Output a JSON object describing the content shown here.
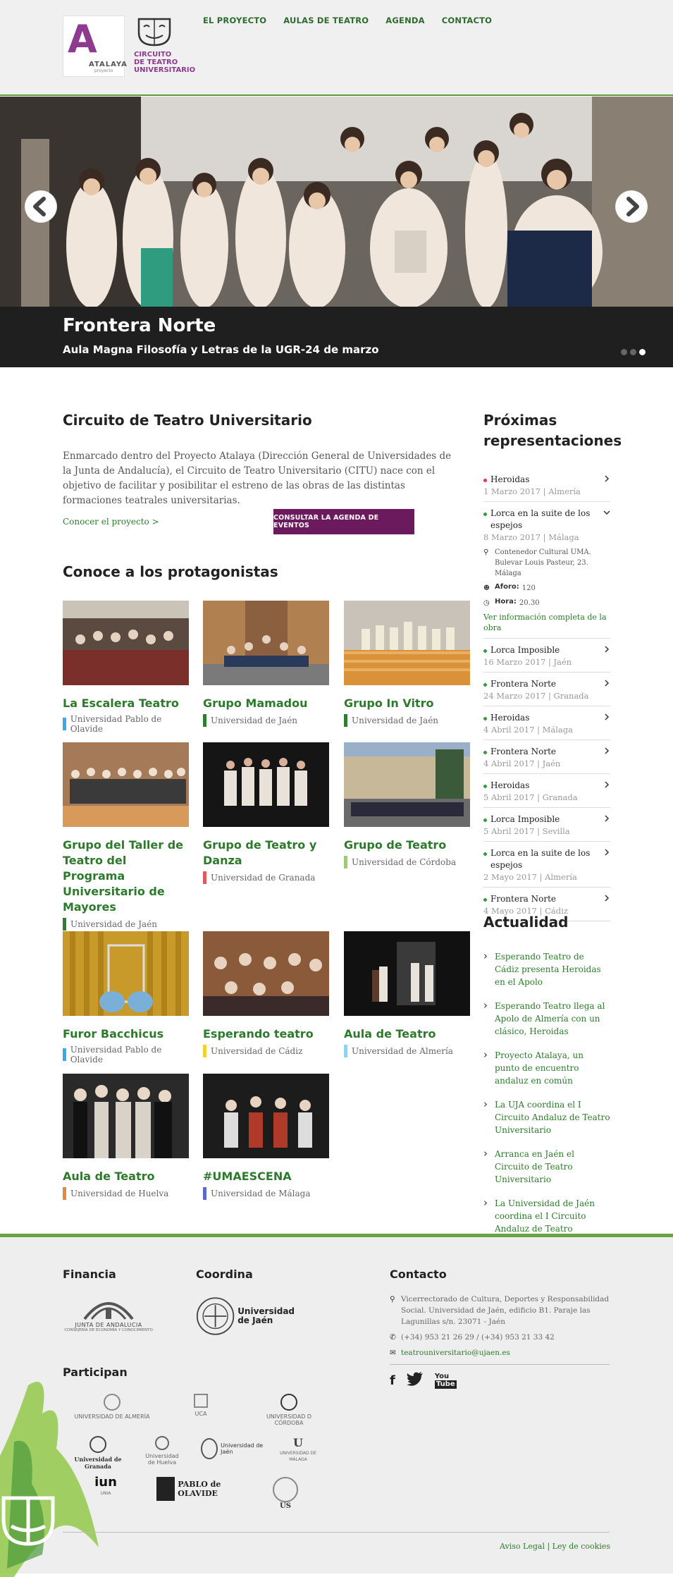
{
  "header": {
    "atalaya_word": "ATALAYA",
    "atalaya_sub": "proyecto",
    "citu_line1": "CIRCUITO",
    "citu_line2": "DE TEATRO",
    "citu_line3": "UNIVERSITARIO",
    "nav": [
      "EL PROYECTO",
      "AULAS DE TEATRO",
      "AGENDA",
      "CONTACTO"
    ]
  },
  "hero": {
    "title": "Frontera Norte",
    "subtitle": "Aula Magna Filosofía y Letras de la UGR-24 de marzo",
    "slides": 3,
    "active_slide": 3
  },
  "intro": {
    "heading": "Circuito de Teatro Universitario",
    "text": "Enmarcado dentro del Proyecto Atalaya (Dirección General de Universidades de la Junta de Andalucía), el Circuito de Teatro Universitario (CITU) nace con el objetivo de facilitar y posibilitar el estreno de las obras de las distintas formaciones teatrales universitarias.",
    "link": "Conocer el proyecto >",
    "button": "CONSULTAR LA AGENDA DE EVENTOS"
  },
  "protagonists": {
    "heading": "Conoce a los protagonistas",
    "cards": [
      {
        "name": "La Escalera Teatro",
        "uni": "Universidad Pablo de Olavide",
        "color": "#3aace0"
      },
      {
        "name": "Grupo Mamadou",
        "uni": "Universidad de Jaén",
        "color": "#2e7d32"
      },
      {
        "name": "Grupo In Vitro",
        "uni": "Universidad de Jaén",
        "color": "#2e7d32"
      },
      {
        "name": "Grupo del Taller de Teatro del Programa Universitario de Mayores",
        "uni": "Universidad de Jaén",
        "color": "#2e7d32"
      },
      {
        "name": "Grupo de Teatro y Danza",
        "uni": "Universidad de Granada",
        "color": "#e05a5a"
      },
      {
        "name": "Grupo de Teatro",
        "uni": "Universidad de Córdoba",
        "color": "#9cc87a"
      },
      {
        "name": "Furor Bacchicus",
        "uni": "Universidad Pablo de Olavide",
        "color": "#3aace0"
      },
      {
        "name": "Esperando teatro",
        "uni": "Universidad de Cádiz",
        "color": "#f2d22e"
      },
      {
        "name": "Aula de Teatro",
        "uni": "Universidad de Almería",
        "color": "#8fd3f0"
      },
      {
        "name": "Aula de Teatro",
        "uni": "Universidad de Huelva",
        "color": "#e08a3a"
      },
      {
        "name": "#UMAESCENA",
        "uni": "Universidad de Málaga",
        "color": "#5a6acb"
      }
    ]
  },
  "upcoming": {
    "heading": "Próximas representaciones",
    "events": [
      {
        "title": "Heroidas",
        "meta": "1 Marzo 2017 | Almería",
        "bullet": "#e03a3a"
      },
      {
        "title": "Lorca en la suite de los espejos",
        "meta": "8 Marzo 2017 | Málaga",
        "bullet": "#3c9a3c",
        "expanded": true,
        "venue": "Contenedor Cultural UMA. Bulevar Louis Pasteur, 23. Málaga",
        "aforo_label": "Aforo:",
        "aforo": "120",
        "hora_label": "Hora:",
        "hora": "20.30",
        "more": "Ver información completa de la obra"
      },
      {
        "title": "Lorca Imposible",
        "meta": "16 Marzo 2017 | Jaén",
        "bullet": "#3c9a3c"
      },
      {
        "title": "Frontera Norte",
        "meta": "24 Marzo 2017 | Granada",
        "bullet": "#3c9a3c"
      },
      {
        "title": "Heroidas",
        "meta": "4 Abril 2017 | Málaga",
        "bullet": "#3c9a3c"
      },
      {
        "title": "Frontera Norte",
        "meta": "4 Abril 2017 | Jaén",
        "bullet": "#3c9a3c"
      },
      {
        "title": "Heroidas",
        "meta": "5 Abril 2017 | Granada",
        "bullet": "#3c9a3c"
      },
      {
        "title": "Lorca Imposible",
        "meta": "5 Abril 2017 | Sevilla",
        "bullet": "#3c9a3c"
      },
      {
        "title": "Lorca en la suite de los espejos",
        "meta": "2 Mayo 2017 | Almería",
        "bullet": "#3c9a3c"
      },
      {
        "title": "Frontera Norte",
        "meta": "4 Mayo 2017 | Cádiz",
        "bullet": "#3c9a3c"
      }
    ]
  },
  "news": {
    "heading": "Actualidad",
    "items": [
      "Esperando Teatro de Cádiz presenta Heroidas en el Apolo",
      "Esperando Teatro llega al Apolo de Almería con un clásico, Heroidas",
      "Proyecto Atalaya, un punto de encuentro andaluz en común",
      "La UJA coordina el I Circuito Andaluz de Teatro Universitario",
      "Arranca en Jaén el Circuito de Teatro Universitario",
      "La Universidad de Jaén coordina el I Circuito Andaluz de Teatro Universitario, que arranca en Jaén"
    ]
  },
  "footer": {
    "financia": "Financia",
    "junta_line1": "JUNTA DE ANDALUCIA",
    "junta_line2": "CONSEJERÍA DE ECONOMÍA Y CONOCIMIENTO",
    "coordina": "Coordina",
    "uja_line1": "Universidad",
    "uja_line2": "de Jaén",
    "participan": "Participan",
    "participants": [
      "UNIVERSIDAD DE ALMERÍA",
      "UCA",
      "UNIVERSIDAD D CÓRDOBA",
      "Universidad de Granada",
      "Universidad de Huelva",
      "Universidad de Jaén",
      "UNIVERSIDAD DE MÁLAGA",
      "UNIA",
      "PABLO de OLAVIDE",
      "US"
    ],
    "contact_heading": "Contacto",
    "address": "Vicerrectorado de Cultura, Deportes y Responsabilidad Social. Universidad de Jaén, edificio B1. Paraje las Lagunillas s/n. 23071 - Jaén",
    "phone": "(+34) 953 21 26 29 / (+34) 953 21 33 42",
    "email": "teatrouniversitario@ujaen.es",
    "legal": "Aviso Legal",
    "cookies": "Ley de cookies"
  }
}
